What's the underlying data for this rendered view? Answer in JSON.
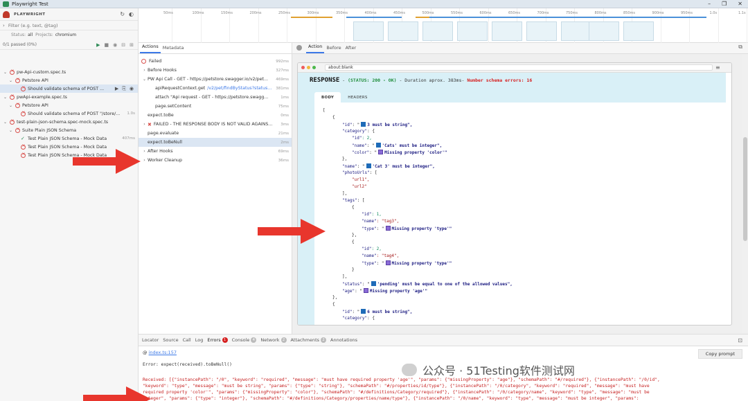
{
  "window": {
    "title": "Playwright Test"
  },
  "sidebar": {
    "brand": "PLAYWRIGHT",
    "filter_placeholder": "Filter (e.g. text, @tag)",
    "status_label": "Status:",
    "status_value": "all",
    "projects_label": "Projects:",
    "projects_value": "chromium",
    "passed": "0/1 passed (0%)",
    "tree": [
      {
        "label": "pw-Api-custom.spec.ts",
        "level": 0,
        "status": "fail",
        "duration": ""
      },
      {
        "label": "Petstore API",
        "level": 1,
        "status": "fail",
        "duration": ""
      },
      {
        "label": "Should validate schema of POST ...",
        "level": 2,
        "status": "fail",
        "duration": "",
        "selected": true
      },
      {
        "label": "pwApi-example.spec.ts",
        "level": 0,
        "status": "fail",
        "duration": ""
      },
      {
        "label": "Petstore API",
        "level": 1,
        "status": "fail",
        "duration": ""
      },
      {
        "label": "Should validate schema of POST \"/store/...",
        "level": 2,
        "status": "fail",
        "duration": "1.0s"
      },
      {
        "label": "test-plain-json-schema.spec-mock.spec.ts",
        "level": 0,
        "status": "fail",
        "duration": ""
      },
      {
        "label": "Suite Plain JSON Schema",
        "level": 1,
        "status": "fail",
        "duration": ""
      },
      {
        "label": "Test Plain JSON Schema - Mock Data",
        "level": 2,
        "status": "pass",
        "duration": "407ms"
      },
      {
        "label": "Test Plain JSON Schema - Mock Data",
        "level": 2,
        "status": "fail",
        "duration": ""
      },
      {
        "label": "Test Plain JSON Schema - Mock Data",
        "level": 2,
        "status": "fail",
        "duration": ""
      }
    ]
  },
  "timeline": {
    "ticks": [
      "50ms",
      "100ms",
      "150ms",
      "200ms",
      "250ms",
      "300ms",
      "350ms",
      "400ms",
      "450ms",
      "500ms",
      "550ms",
      "600ms",
      "650ms",
      "700ms",
      "750ms",
      "800ms",
      "850ms",
      "900ms",
      "950ms",
      "1.0s",
      "1.1s"
    ]
  },
  "actions": {
    "tabs": [
      "Actions",
      "Metadata"
    ],
    "rows": [
      {
        "label": "Failed",
        "duration": "992ms",
        "icon": "fail",
        "indent": 0
      },
      {
        "label": "Before Hooks",
        "duration": "327ms",
        "icon": "chev",
        "indent": 0
      },
      {
        "label": "PW Api Call - GET - https://petstore.swagger.io/v2/pet...",
        "duration": "469ms",
        "icon": "chev-open",
        "indent": 0
      },
      {
        "label": "apiRequestContext.get",
        "url": "/v2/pet/findByStatus?status...",
        "duration": "381ms",
        "icon": "",
        "indent": 1
      },
      {
        "label": "attach \"Api request - GET - https://petstore.swagg...",
        "duration": "1ms",
        "icon": "",
        "indent": 1
      },
      {
        "label": "page.setContent",
        "duration": "75ms",
        "icon": "",
        "indent": 1
      },
      {
        "label": "expect.toBe",
        "duration": "0ms",
        "icon": "",
        "indent": 0
      },
      {
        "label": "FAILED - THE RESPONSE BODY IS NOT VALID AGAINS...",
        "duration": "3ms",
        "icon": "x",
        "indent": 0
      },
      {
        "label": "page.evaluate",
        "duration": "21ms",
        "icon": "",
        "indent": 0
      },
      {
        "label": "expect.toBeNull",
        "duration": "2ms",
        "icon": "",
        "indent": 0,
        "selected": true
      },
      {
        "label": "After Hooks",
        "duration": "69ms",
        "icon": "chev",
        "indent": 0
      },
      {
        "label": "Worker Cleanup",
        "duration": "36ms",
        "icon": "chev",
        "indent": 0
      }
    ]
  },
  "snapshot": {
    "tabs": [
      "Action",
      "Before",
      "After"
    ],
    "address": "about:blank",
    "response": {
      "title": "RESPONSE",
      "status": "(STATUS: 200 - OK)",
      "duration": "- Duration aprox. 383ms-",
      "errors": "Number schema errors: 16",
      "tabs": [
        "BODY",
        "HEADERS"
      ]
    },
    "json_lines": [
      {
        "indent": 0,
        "html": "["
      },
      {
        "indent": 1,
        "html": "{"
      },
      {
        "indent": 2,
        "key": "\"id\"",
        "sq": "blue",
        "msg": "3 must be string\","
      },
      {
        "indent": 2,
        "key": "\"category\"",
        "tail": ": {"
      },
      {
        "indent": 3,
        "key": "\"id\"",
        "num": ": 2,"
      },
      {
        "indent": 3,
        "key": "\"name\"",
        "sq": "blue",
        "msg": "'Cats' must be integer\","
      },
      {
        "indent": 3,
        "key": "\"color\"",
        "sq": "purple",
        "msg": "Missing property 'color'\""
      },
      {
        "indent": 2,
        "html": "},"
      },
      {
        "indent": 2,
        "key": "\"name\"",
        "sq": "blue",
        "msg": "'Cat 3' must be integer\","
      },
      {
        "indent": 2,
        "key": "\"photoUrls\"",
        "tail": ": ["
      },
      {
        "indent": 3,
        "str": "\"url1\","
      },
      {
        "indent": 3,
        "str": "\"url2\""
      },
      {
        "indent": 2,
        "html": "],"
      },
      {
        "indent": 2,
        "key": "\"tags\"",
        "tail": ": ["
      },
      {
        "indent": 3,
        "html": "{"
      },
      {
        "indent": 4,
        "key": "\"id\"",
        "num": ": 1,"
      },
      {
        "indent": 4,
        "key": "\"name\"",
        "str": ": \"tag3\","
      },
      {
        "indent": 4,
        "key": "\"type\"",
        "sq": "purple",
        "msg": "Missing property 'type'\""
      },
      {
        "indent": 3,
        "html": "},"
      },
      {
        "indent": 3,
        "html": "{"
      },
      {
        "indent": 4,
        "key": "\"id\"",
        "num": ": 2,"
      },
      {
        "indent": 4,
        "key": "\"name\"",
        "str": ": \"tag4\","
      },
      {
        "indent": 4,
        "key": "\"type\"",
        "sq": "purple",
        "msg": "Missing property 'type'\""
      },
      {
        "indent": 3,
        "html": "}"
      },
      {
        "indent": 2,
        "html": "],"
      },
      {
        "indent": 2,
        "key": "\"status\"",
        "sq": "blue",
        "msg": "'pending' must be equal to one of the allowed values\","
      },
      {
        "indent": 2,
        "key": "\"age\"",
        "sq": "purple",
        "msg": "Missing property 'age'\""
      },
      {
        "indent": 1,
        "html": "},"
      },
      {
        "indent": 1,
        "html": "{"
      },
      {
        "indent": 2,
        "key": "\"id\"",
        "sq": "blue",
        "msg": "6 must be string\","
      },
      {
        "indent": 2,
        "key": "\"category\"",
        "tail": ": {"
      }
    ]
  },
  "bottom": {
    "tabs": [
      {
        "label": "Locator"
      },
      {
        "label": "Source"
      },
      {
        "label": "Call"
      },
      {
        "label": "Log"
      },
      {
        "label": "Errors",
        "badge": "1",
        "red": true
      },
      {
        "label": "Console",
        "badge": "4"
      },
      {
        "label": "Network",
        "badge": "2"
      },
      {
        "label": "Attachments",
        "badge": "2"
      },
      {
        "label": "Annotations"
      }
    ],
    "source_prefix": "@",
    "source_link": "index.ts:157",
    "copy_label": "Copy prompt",
    "error_title": "Error: expect(received).toBeNull()",
    "error_lines": [
      "Received: [{\"instancePath\": \"/0\", \"keyword\": \"required\", \"message\": \"must have required property 'age'\", \"params\": {\"missingProperty\": \"age\"}, \"schemaPath\": \"#/required\"}, {\"instancePath\": \"/0/id\",",
      "\"keyword\": \"type\", \"message\": \"must be string\", \"params\": {\"type\": \"string\"}, \"schemaPath\": \"#/properties/id/type\"}, {\"instancePath\": \"/0/category\", \"keyword\": \"required\", \"message\": \"must have",
      "required property 'color'\", \"params\": {\"missingProperty\": \"color\"}, \"schemaPath\": \"#/definitions/Category/required\"}, {\"instancePath\": \"/0/category/name\", \"keyword\": \"type\", \"message\": \"must be",
      "integer\", \"params\": {\"type\": \"integer\"}, \"schemaPath\": \"#/definitions/Category/properties/name/type\"}, {\"instancePath\": \"/0/name\", \"keyword\": \"type\", \"message\": \"must be integer\", \"params\":"
    ]
  },
  "watermark": "公众号 · 51Testing软件测试网"
}
